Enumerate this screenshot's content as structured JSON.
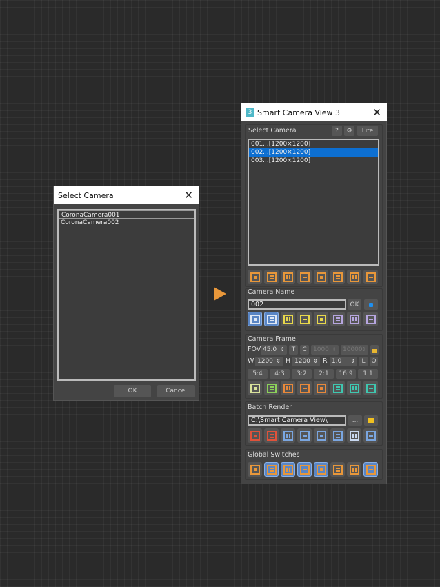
{
  "left_dialog": {
    "title": "Select Camera",
    "cameras": [
      "CoronaCamera001",
      "CoronaCamera002"
    ],
    "ok": "OK",
    "cancel": "Cancel"
  },
  "panel": {
    "title": "Smart Camera View 3",
    "select_camera": {
      "label": "Select Camera",
      "help": "?",
      "settings": "⚙",
      "lite": "Lite",
      "cameras": [
        "001...[1200×1200]",
        "002...[1200×1200]",
        "003...[1200×1200]"
      ],
      "selected_index": 1
    },
    "camera_name": {
      "label": "Camera Name",
      "value": "002",
      "ok": "OK"
    },
    "camera_frame": {
      "label": "Camera Frame",
      "fov_label": "FOV",
      "fov": "45.0",
      "t": "T",
      "c": "C",
      "clip_near": "1000",
      "clip_far": "10000",
      "w_label": "W",
      "w": "1200",
      "h_label": "H",
      "h": "1200",
      "r_label": "R",
      "r": "1.0",
      "l": "L",
      "o": "O",
      "ratios": [
        "5:4",
        "4:3",
        "3:2",
        "2:1",
        "16:9",
        "1:1"
      ]
    },
    "batch_render": {
      "label": "Batch Render",
      "path": "C:\\Smart Camera View\\",
      "browse": "..."
    },
    "global_switches": {
      "label": "Global Switches"
    }
  },
  "icon_rows": {
    "camera_actions": [
      {
        "name": "camera-a-icon",
        "color": "#e8973a"
      },
      {
        "name": "camera-n-icon",
        "color": "#e8973a"
      },
      {
        "name": "camera-r-icon",
        "color": "#e8973a"
      },
      {
        "name": "camera-v-icon",
        "color": "#e8973a"
      },
      {
        "name": "corner-top-icon",
        "color": "#e8973a"
      },
      {
        "name": "corner-bottom-icon",
        "color": "#e8973a"
      },
      {
        "name": "pillar-icon",
        "color": "#e8973a"
      },
      {
        "name": "corner-left-icon",
        "color": "#e8973a"
      }
    ],
    "camera_name": [
      {
        "name": "split-vertical-icon",
        "color": "#dfe8f5",
        "on": true
      },
      {
        "name": "split-horizontal-icon",
        "color": "#dfe8f5",
        "on": true
      },
      {
        "name": "frame-center-icon",
        "color": "#e8d84a"
      },
      {
        "name": "frame-rows-icon",
        "color": "#e8d84a"
      },
      {
        "name": "frame-columns-icon",
        "color": "#e8d84a"
      },
      {
        "name": "align-center-icon",
        "color": "#b7a6e0"
      },
      {
        "name": "align-left-icon",
        "color": "#b7a6e0"
      },
      {
        "name": "align-top-icon",
        "color": "#b7a6e0"
      }
    ],
    "camera_frame": [
      {
        "name": "grid-plus-icon",
        "color": "#d9e29a"
      },
      {
        "name": "bars-icon",
        "color": "#8cd05a"
      },
      {
        "name": "safe-frame-icon",
        "color": "#e8883a"
      },
      {
        "name": "safe-rows-icon",
        "color": "#e8883a"
      },
      {
        "name": "safe-columns-icon",
        "color": "#e8883a"
      },
      {
        "name": "guide-dots-icon",
        "color": "#3fc7b0"
      },
      {
        "name": "guide-grid-icon",
        "color": "#3fc7b0"
      },
      {
        "name": "guide-fine-icon",
        "color": "#3fc7b0"
      }
    ],
    "batch_render": [
      {
        "name": "render-region-icon",
        "color": "#e0523a"
      },
      {
        "name": "render-dots-icon",
        "color": "#e0523a"
      },
      {
        "name": "render-strip-icon",
        "color": "#7aa6e0"
      },
      {
        "name": "render-list-icon",
        "color": "#7aa6e0"
      },
      {
        "name": "render-calendar-icon",
        "color": "#7aa6e0"
      },
      {
        "name": "render-tiles-icon",
        "color": "#7aa6e0"
      },
      {
        "name": "render-lines-icon",
        "color": "#c8d8f0"
      },
      {
        "name": "render-dotted-icon",
        "color": "#7aa6e0"
      }
    ],
    "global_switches": [
      {
        "name": "switch-bar-icon",
        "color": "#e8973a"
      },
      {
        "name": "switch-split-icon",
        "color": "#e8973a",
        "on": true
      },
      {
        "name": "switch-corners-icon",
        "color": "#e8973a",
        "on": true
      },
      {
        "name": "switch-columns-icon",
        "color": "#e8973a",
        "on": true
      },
      {
        "name": "switch-frame-icon",
        "color": "#e8973a",
        "on": true
      },
      {
        "name": "switch-grid-icon",
        "color": "#e8973a"
      },
      {
        "name": "switch-cross-icon",
        "color": "#e8973a"
      },
      {
        "name": "switch-film-icon",
        "color": "#e8973a",
        "on": true
      }
    ]
  },
  "colors": {
    "accent": "#e8973a",
    "selection": "#0d6fd1"
  }
}
